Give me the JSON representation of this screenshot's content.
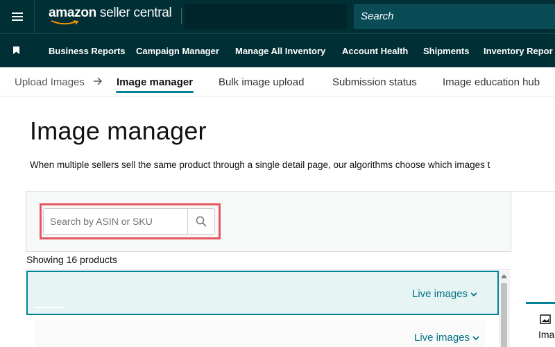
{
  "header": {
    "logo_brand": "amazon",
    "logo_rest": " seller central",
    "search_label": "Search",
    "menu_icon": "hamburger-icon"
  },
  "nav": {
    "bookmark_icon": "bookmark-icon",
    "items": [
      {
        "label": "Business Reports"
      },
      {
        "label": "Campaign Manager"
      },
      {
        "label": "Manage All Inventory"
      },
      {
        "label": "Account Health"
      },
      {
        "label": "Shipments"
      },
      {
        "label": "Inventory Repor"
      }
    ]
  },
  "tabs": {
    "crumb": "Upload Images",
    "arrow_icon": "arrow-right-icon",
    "items": [
      {
        "label": "Image manager",
        "active": true
      },
      {
        "label": "Bulk image upload"
      },
      {
        "label": "Submission status"
      },
      {
        "label": "Image education hub"
      }
    ]
  },
  "page": {
    "title": "Image manager",
    "description": "When multiple sellers sell the same product through a single detail page, our algorithms choose which images t"
  },
  "search": {
    "placeholder": "Search by ASIN or SKU",
    "button_icon": "search-icon"
  },
  "products": {
    "showing": "Showing 16 products",
    "rows": [
      {
        "live_label": "Live images",
        "selected": true
      },
      {
        "live_label": "Live images",
        "selected": false
      }
    ]
  },
  "right_panel": {
    "tab_icon": "image-icon",
    "tab_label": "Ima"
  },
  "colors": {
    "header_bg": "#002f36",
    "accent": "#008296",
    "link": "#007185",
    "highlight_border": "#e4575f",
    "selected_row_bg": "#e6f5f4"
  }
}
